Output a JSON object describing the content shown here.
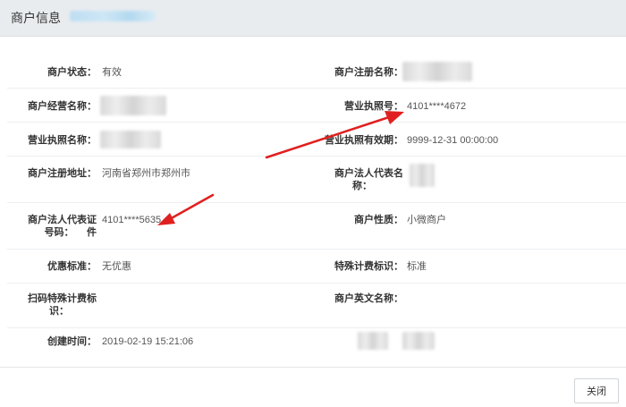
{
  "header": {
    "title": "商户信息"
  },
  "fields": {
    "status": {
      "label": "商户状态：",
      "value": "有效"
    },
    "reg_name": {
      "label": "商户注册名称：",
      "value": ""
    },
    "biz_name": {
      "label": "商户经营名称：",
      "value": ""
    },
    "license_no": {
      "label": "营业执照号：",
      "value": "4101****4672"
    },
    "license_name": {
      "label": "营业执照名称：",
      "value": ""
    },
    "license_valid": {
      "label": "营业执照有效期：",
      "value": "9999-12-31 00:00:00"
    },
    "reg_address": {
      "label": "商户注册地址：",
      "value": "河南省郑州市郑州市"
    },
    "legal_rep": {
      "label_l1": "商户法人代表名",
      "label_l2": "称：",
      "value": ""
    },
    "legal_id": {
      "label_l1": "商户法人代表证件",
      "label_l2": "号码：",
      "value": "4101****5635"
    },
    "merchant_type": {
      "label": "商户性质：",
      "value": "小微商户"
    },
    "discount": {
      "label": "优惠标准：",
      "value": "无优惠"
    },
    "special_fee": {
      "label": "特殊计费标识：",
      "value": "标准"
    },
    "scan_fee": {
      "label_l1": "扫码特殊计费标",
      "label_l2": "识：",
      "value": ""
    },
    "en_name": {
      "label": "商户英文名称：",
      "value": ""
    },
    "created": {
      "label": "创建时间：",
      "value": "2019-02-19 15:21:06"
    }
  },
  "footer": {
    "close_label": "关闭"
  },
  "colors": {
    "arrow": "#e02020",
    "header_bg": "#e9ecef"
  }
}
